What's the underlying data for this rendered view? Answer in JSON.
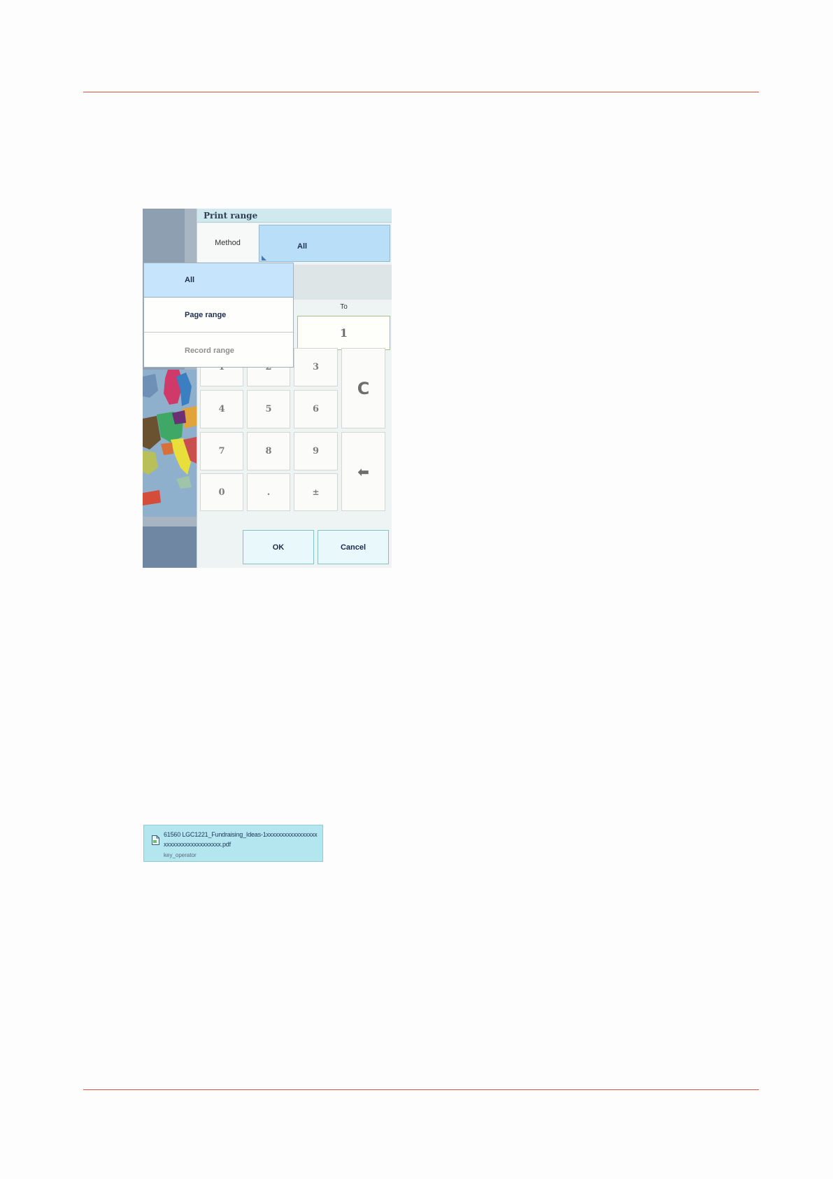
{
  "dialog": {
    "title": "Print range",
    "method_label": "Method",
    "method_value": "All",
    "to_label": "To",
    "to_value": "1",
    "dropdown_options": [
      "All",
      "Page range",
      "Record range"
    ],
    "keypad": [
      "1",
      "2",
      "3",
      "4",
      "5",
      "6",
      "7",
      "8",
      "9",
      "0",
      ".",
      "±"
    ],
    "clear_key": "C",
    "backspace_key": "⬅",
    "ok_label": "OK",
    "cancel_label": "Cancel"
  },
  "file_entry": {
    "name_line1": "61560 LGC1221_Fundraising_Ideas-1xxxxxxxxxxxxxxxxx",
    "name_line2": "xxxxxxxxxxxxxxxxxxx.pdf",
    "owner": "key_operator",
    "icon": "document-icon"
  },
  "colors": {
    "rule": "#d9533f",
    "selected": "#c6e4fb",
    "file_bg": "#b3e6ef"
  }
}
